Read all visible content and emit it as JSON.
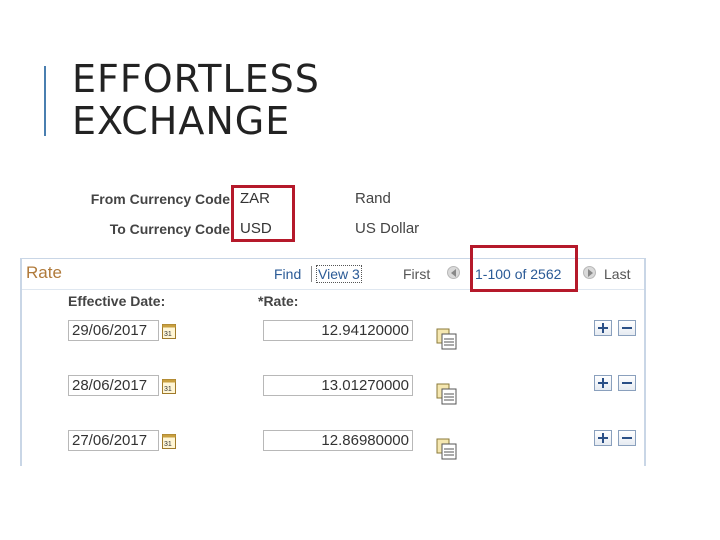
{
  "slide": {
    "title_line1": "EFFORTLESS",
    "title_line2": "EXCHANGE"
  },
  "currency": {
    "from": {
      "label": "From Currency Code",
      "code": "ZAR",
      "description": "Rand"
    },
    "to": {
      "label": "To Currency Code",
      "code": "USD",
      "description": "US Dollar"
    }
  },
  "rate_panel": {
    "title": "Rate",
    "nav": {
      "find": "Find",
      "view": "View 3",
      "first": "First",
      "range": "1-100 of 2562",
      "last": "Last"
    },
    "columns": {
      "effective_date": "Effective Date:",
      "rate": "*Rate:"
    },
    "rows": [
      {
        "date": "29/06/2017",
        "rate": "12.94120000"
      },
      {
        "date": "28/06/2017",
        "rate": "13.01270000"
      },
      {
        "date": "27/06/2017",
        "rate": "12.86980000"
      }
    ]
  },
  "colors": {
    "highlight": "#b5192a",
    "link": "#2a5a96",
    "panel_title": "#b07a3a"
  },
  "icons": [
    "calendar-icon",
    "rate-detail-icon",
    "add-row-icon",
    "delete-row-icon",
    "prev-arrow-icon",
    "next-arrow-icon"
  ]
}
